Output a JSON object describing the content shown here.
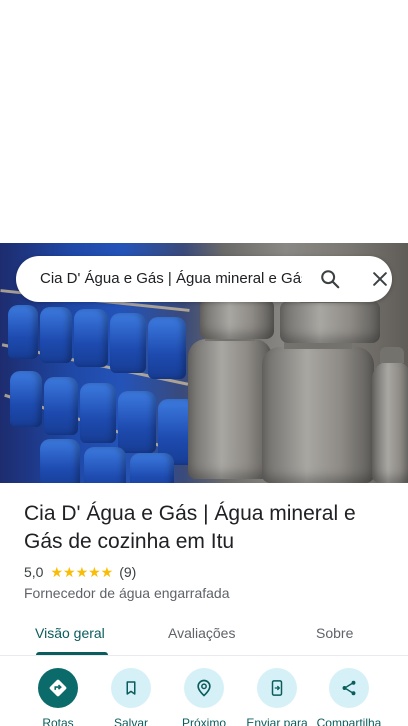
{
  "search": {
    "query": "Cia D' Água e Gás | Água mineral e Gás de cozinha em Itu"
  },
  "place": {
    "title": "Cia D' Água e Gás | Água mineral e Gás de cozinha em Itu",
    "rating": "5,0",
    "stars": "★★★★★",
    "reviews": "(9)",
    "category": "Fornecedor de água engarrafada"
  },
  "tabs": [
    {
      "label": "Visão geral",
      "active": true
    },
    {
      "label": "Avaliações",
      "active": false
    },
    {
      "label": "Sobre",
      "active": false
    }
  ],
  "actions": [
    {
      "label": "Rotas",
      "icon": "directions-icon"
    },
    {
      "label": "Salvar",
      "icon": "bookmark-icon"
    },
    {
      "label": "Próximo",
      "icon": "nearby-icon"
    },
    {
      "label": "Enviar para",
      "icon": "send-to-phone-icon"
    },
    {
      "label": "Compartilha",
      "icon": "share-icon"
    }
  ],
  "colors": {
    "accent": "#0b6b6b",
    "accent_light": "#d5f1f7",
    "star": "#fbbc04"
  }
}
